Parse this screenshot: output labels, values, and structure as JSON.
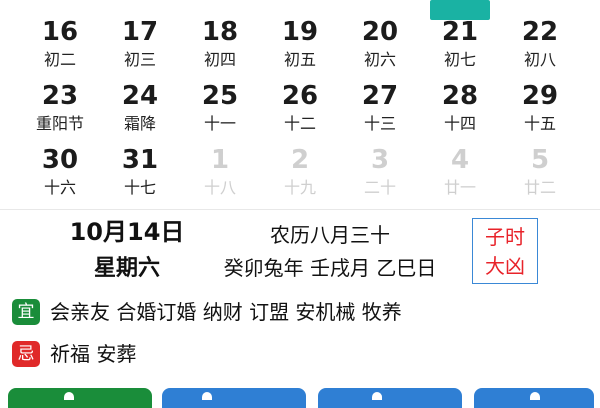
{
  "calendar": {
    "rows": [
      [
        {
          "day": "16",
          "lunar": "初二"
        },
        {
          "day": "17",
          "lunar": "初三"
        },
        {
          "day": "18",
          "lunar": "初四"
        },
        {
          "day": "19",
          "lunar": "初五"
        },
        {
          "day": "20",
          "lunar": "初六"
        },
        {
          "day": "21",
          "lunar": "初七"
        },
        {
          "day": "22",
          "lunar": "初八"
        }
      ],
      [
        {
          "day": "23",
          "lunar": "重阳节"
        },
        {
          "day": "24",
          "lunar": "霜降"
        },
        {
          "day": "25",
          "lunar": "十一"
        },
        {
          "day": "26",
          "lunar": "十二"
        },
        {
          "day": "27",
          "lunar": "十三"
        },
        {
          "day": "28",
          "lunar": "十四"
        },
        {
          "day": "29",
          "lunar": "十五"
        }
      ],
      [
        {
          "day": "30",
          "lunar": "十六"
        },
        {
          "day": "31",
          "lunar": "十七"
        },
        {
          "day": "1",
          "lunar": "十八"
        },
        {
          "day": "2",
          "lunar": "十九"
        },
        {
          "day": "3",
          "lunar": "二十"
        },
        {
          "day": "4",
          "lunar": "廿一"
        },
        {
          "day": "5",
          "lunar": "廿二"
        }
      ]
    ],
    "today_color": "#1ab2a3"
  },
  "info": {
    "date": "10月14日",
    "weekday": "星期六",
    "lunar_date": "农历八月三十",
    "ganzhi": "癸卯兔年 壬戌月 乙巳日",
    "hour_line1": "子时",
    "hour_line2": "大凶"
  },
  "yi": {
    "tag": "宜",
    "text": "会亲友 合婚订婚 纳财 订盟 安机械 牧养"
  },
  "ji": {
    "tag": "忌",
    "text": "祈福 安葬"
  },
  "colors": {
    "yi_green": "#1a8d3a",
    "ji_red": "#e02929",
    "hour_red": "#e8232a",
    "box_blue": "#3a88d6",
    "btn_green": "#1a8d3a",
    "btn_blue": "#2f7fd4"
  }
}
